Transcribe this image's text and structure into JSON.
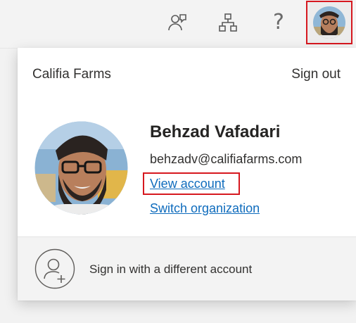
{
  "header": {
    "icons": [
      "feedback-icon",
      "org-explorer-icon",
      "help-icon"
    ],
    "help_glyph": "?"
  },
  "account_panel": {
    "organization": "Califia Farms",
    "sign_out_label": "Sign out",
    "user": {
      "name": "Behzad Vafadari",
      "email": "behzadv@califiafarms.com"
    },
    "view_account_label": "View account",
    "switch_organization_label": "Switch organization",
    "other_account_label": "Sign in with a different account"
  },
  "colors": {
    "link": "#0f6cbd",
    "highlight": "#d6181f"
  }
}
